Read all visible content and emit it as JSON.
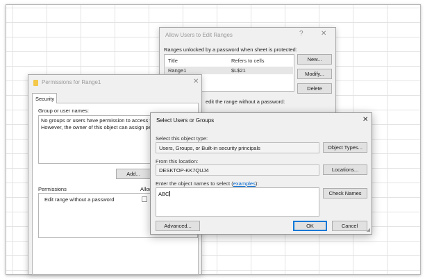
{
  "ranges_dialog": {
    "title": "Allow Users to Edit Ranges",
    "help": "?",
    "close": "✕",
    "section_label": "Ranges unlocked by a password when sheet is protected:",
    "col_title": "Title",
    "col_refers": "Refers to cells",
    "row_title": "Range1",
    "row_refers": "$L$21",
    "new_label": "New...",
    "modify_label": "Modify...",
    "delete_label": "Delete",
    "without_pw_text": "edit the range without a password:"
  },
  "permissions_dialog": {
    "title": "Permissions for Range1",
    "close": "✕",
    "tab_security": "Security",
    "group_label": "Group or user names:",
    "info_line1": "No groups or users have permission to access th",
    "info_line2": "However, the owner of this object can assign pe",
    "add_label": "Add...",
    "permissions_label": "Permissions",
    "allow_label": "Allow",
    "perm_item": "Edit range without a password"
  },
  "select_dialog": {
    "title": "Select Users or Groups",
    "close": "✕",
    "object_type_label": "Select this object type:",
    "object_type_value": "Users, Groups, or Built-in security principals",
    "object_types_btn": "Object Types...",
    "location_label": "From this location:",
    "location_value": "DESKTOP-KK7QUJ4",
    "locations_btn": "Locations...",
    "enter_label_pre": "Enter the object names to select (",
    "examples_link": "examples",
    "enter_label_post": "):",
    "names_value": "ABC",
    "check_names_btn": "Check Names",
    "advanced_btn": "Advanced...",
    "ok_btn": "OK",
    "cancel_btn": "Cancel"
  }
}
